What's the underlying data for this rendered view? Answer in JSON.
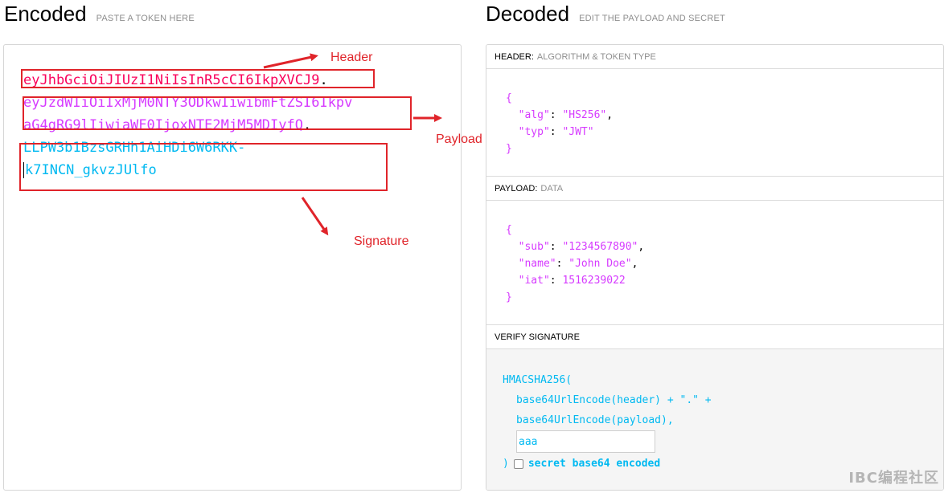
{
  "encoded": {
    "title": "Encoded",
    "subtitle": "PASTE A TOKEN HERE",
    "token_lines": [
      {
        "parts": [
          {
            "text": "eyJhbGciOiJIUzI1NiIsInR5cCI6IkpXVCJ9",
            "cls": "t-header red"
          },
          {
            "text": ".",
            "cls": "t-dot"
          }
        ]
      },
      {
        "parts": [
          {
            "text": "eyJzdWIiOiIxMjM0NTY3ODkwIiwibmFtZSI6Ikpv",
            "cls": "t-payload"
          }
        ]
      },
      {
        "parts": [
          {
            "text": "aG4gRG9lIiwiaWF0IjoxNTE2MjM5MDIyfQ",
            "cls": "t-payload"
          },
          {
            "text": ".",
            "cls": "t-dot"
          }
        ]
      },
      {
        "parts": [
          {
            "text": "LLPW3b1BzsGRHh1AiHDi6W6RKK-",
            "cls": "t-sig"
          }
        ]
      },
      {
        "parts": [
          {
            "text": "k7INCN_gkvzJUlfo",
            "cls": "t-sig",
            "caret": true
          }
        ]
      }
    ],
    "annotations": {
      "header": "Header",
      "payload": "Payload",
      "signature": "Signature"
    }
  },
  "decoded": {
    "title": "Decoded",
    "subtitle": "EDIT THE PAYLOAD AND SECRET",
    "header_section": {
      "label": "HEADER:",
      "sub": "ALGORITHM & TOKEN TYPE"
    },
    "header_json": [
      {
        "indent": "",
        "text": "{",
        "type": "brace"
      },
      {
        "indent": "  ",
        "key": "\"alg\"",
        "value": "\"HS256\"",
        "comma": ","
      },
      {
        "indent": "  ",
        "key": "\"typ\"",
        "value": "\"JWT\"",
        "comma": ""
      },
      {
        "indent": "",
        "text": "}",
        "type": "brace"
      }
    ],
    "payload_section": {
      "label": "PAYLOAD:",
      "sub": "DATA"
    },
    "payload_json": [
      {
        "indent": "",
        "text": "{",
        "type": "brace"
      },
      {
        "indent": "  ",
        "key": "\"sub\"",
        "value": "\"1234567890\"",
        "comma": ","
      },
      {
        "indent": "  ",
        "key": "\"name\"",
        "value": "\"John Doe\"",
        "comma": ","
      },
      {
        "indent": "  ",
        "key": "\"iat\"",
        "value": "1516239022",
        "comma": ""
      },
      {
        "indent": "",
        "text": "}",
        "type": "brace"
      }
    ],
    "verify_section": {
      "label": "VERIFY SIGNATURE"
    },
    "verify": {
      "fn": "HMACSHA256(",
      "line1": "base64UrlEncode(header) + \".\" +",
      "line2": "base64UrlEncode(payload),",
      "secret_value": "aaa",
      "close": ")",
      "checkbox_label": "secret base64 encoded",
      "checkbox_checked": false
    }
  },
  "watermark": "IBC编程社区"
}
